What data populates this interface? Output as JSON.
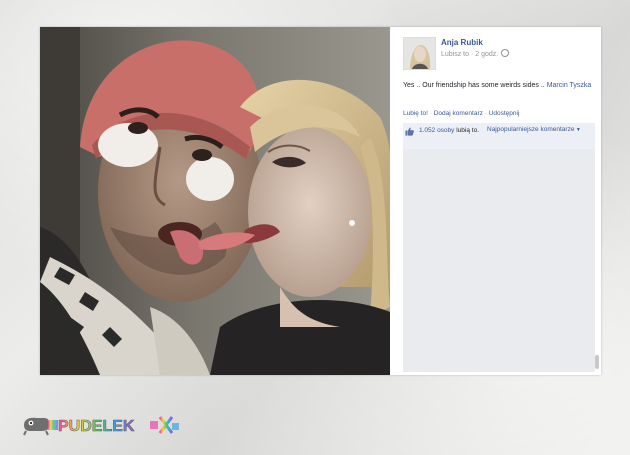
{
  "post": {
    "author": "Anja Rubik",
    "meta": "Lubisz to · 2 godz.",
    "text": "Yes .. Our friendship has some weirds sides ..",
    "tagged": "Marcin Tyszka"
  },
  "actions": {
    "like": "Lubię to!",
    "comment": "Dodaj komentarz",
    "share": "Udostępnij"
  },
  "likes": {
    "count": "1.052 osoby",
    "suffix": "lubią to.",
    "sort": "Najpopularniejsze komentarze"
  },
  "watermark": {
    "text": "PUDELEK"
  },
  "colors": {
    "fb_link": "#3b5998",
    "likes_bg": "#eceff5"
  }
}
